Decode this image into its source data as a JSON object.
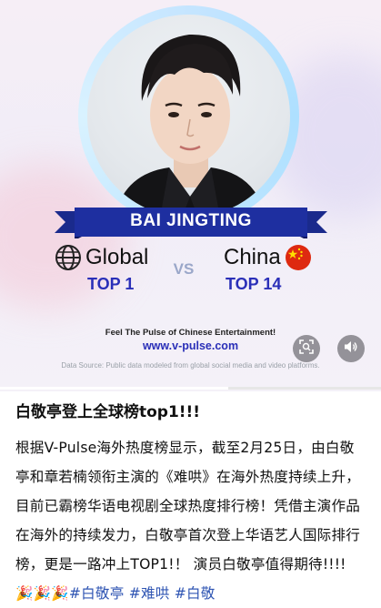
{
  "media": {
    "name_banner": "BAI JINGTING",
    "global": {
      "label": "Global",
      "rank": "TOP 1"
    },
    "vs": "VS",
    "china": {
      "label": "China",
      "rank": "TOP 14"
    },
    "tagline": "Feel The Pulse of Chinese Entertainment!",
    "website": "www.v-pulse.com",
    "source": "Data Source: Public data modeled from global social media and video platforms.",
    "icons": [
      "globe-icon",
      "china-flag-icon",
      "scan-icon",
      "speaker-icon"
    ],
    "colors": {
      "banner": "#1e2fa0",
      "rank": "#2a2fb8",
      "ring": "#bfe6ff"
    }
  },
  "post": {
    "title": "白敬亭登上全球榜top1!!!",
    "body": "根据V-Pulse海外热度榜显示，截至2月25日，由白敬亭和章若楠领衔主演的《难哄》在海外热度持续上升，目前已霸榜华语电视剧全球热度排行榜！凭借主演作品在海外的持续发力，白敬亭首次登上华语艺人国际排行榜，更是一路冲上TOP1!！ 演员白敬亭值得期待!!!!  ",
    "emojis": "🎉🎉🎉",
    "hashtags": [
      "#白敬亭",
      "#难哄",
      "#白敬"
    ]
  }
}
